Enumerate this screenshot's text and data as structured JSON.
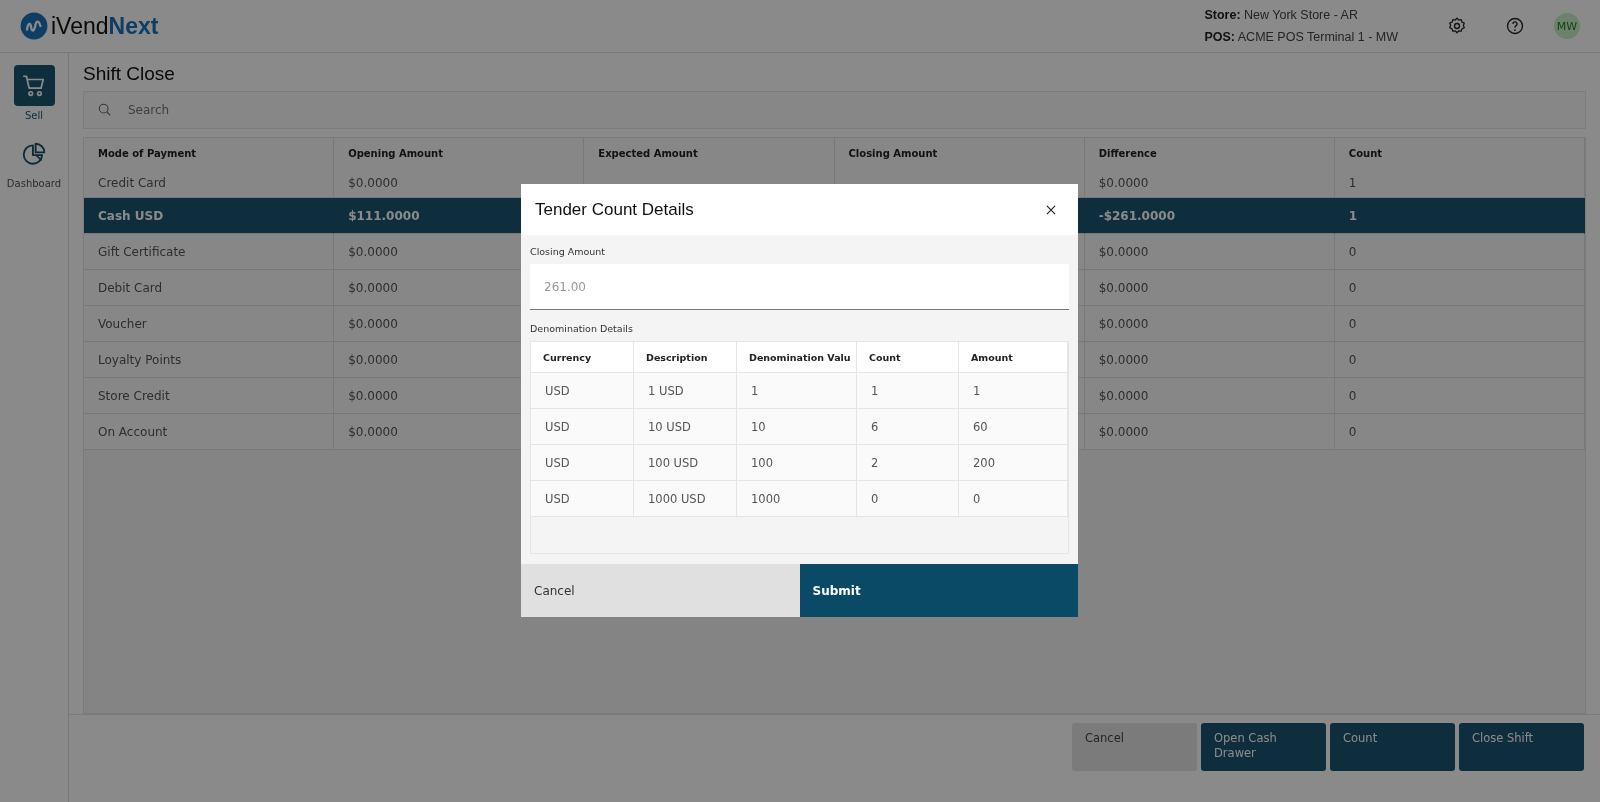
{
  "header": {
    "logo": {
      "brand_start": "iVend",
      "brand_end": "Next"
    },
    "store_label": "Store:",
    "store": "New York Store - AR",
    "pos_label": "POS:",
    "pos": "ACME POS Terminal 1 - MW",
    "avatar": "MW"
  },
  "sidebar": {
    "items": [
      {
        "label": "Sell",
        "kind": "cart",
        "selected": true
      },
      {
        "label": "Dashboard",
        "kind": "chart",
        "selected": false
      }
    ]
  },
  "page_title": "Shift Close",
  "search": {
    "placeholder": "Search"
  },
  "table": {
    "columns": [
      "Mode of Payment",
      "Opening Amount",
      "Expected Amount",
      "Closing Amount",
      "Difference",
      "Count"
    ],
    "rows": [
      {
        "mode": "Credit Card",
        "opening": "$0.0000",
        "difference": "$0.0000",
        "count": "1",
        "selected": false
      },
      {
        "mode": "Cash USD",
        "opening": "$111.0000",
        "difference": "-$261.0000",
        "count": "1",
        "selected": true
      },
      {
        "mode": "Gift Certificate",
        "opening": "$0.0000",
        "difference": "$0.0000",
        "count": "0",
        "selected": false
      },
      {
        "mode": "Debit Card",
        "opening": "$0.0000",
        "difference": "$0.0000",
        "count": "0",
        "selected": false
      },
      {
        "mode": "Voucher",
        "opening": "$0.0000",
        "difference": "$0.0000",
        "count": "0",
        "selected": false
      },
      {
        "mode": "Loyalty Points",
        "opening": "$0.0000",
        "difference": "$0.0000",
        "count": "0",
        "selected": false
      },
      {
        "mode": "Store Credit",
        "opening": "$0.0000",
        "difference": "$0.0000",
        "count": "0",
        "selected": false
      },
      {
        "mode": "On Account",
        "opening": "$0.0000",
        "difference": "$0.0000",
        "count": "0",
        "selected": false
      }
    ]
  },
  "footer_buttons": [
    {
      "label": "Cancel",
      "kind": "secondary"
    },
    {
      "label": "Open Cash Drawer",
      "kind": "primary"
    },
    {
      "label": "Count",
      "kind": "primary"
    },
    {
      "label": "Close Shift",
      "kind": "primary"
    }
  ],
  "modal": {
    "title": "Tender Count Details",
    "closing_amount": {
      "label": "Closing Amount",
      "value": "261.00"
    },
    "denomination_label": "Denomination Details",
    "columns": [
      "Currency",
      "Description",
      "Denomination Valu",
      "Count",
      "Amount"
    ],
    "rows": [
      [
        "USD",
        "1 USD",
        "1",
        "1",
        "1"
      ],
      [
        "USD",
        "10 USD",
        "10",
        "6",
        "60"
      ],
      [
        "USD",
        "100 USD",
        "100",
        "2",
        "200"
      ],
      [
        "USD",
        "1000 USD",
        "1000",
        "0",
        "0"
      ]
    ],
    "buttons": [
      {
        "label": "Cancel",
        "kind": "secondary"
      },
      {
        "label": "Submit",
        "kind": "primary"
      }
    ]
  }
}
